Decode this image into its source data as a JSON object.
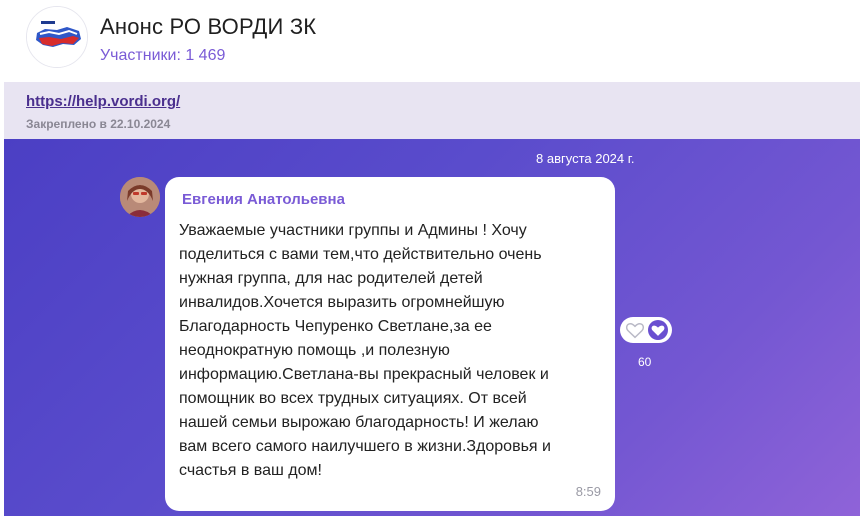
{
  "header": {
    "title": "Анонс РО ВОРДИ ЗК",
    "subtitle": "Участники: 1 469"
  },
  "pinned": {
    "link": "https://help.vordi.org/",
    "date": "Закреплено в 22.10.2024"
  },
  "chat": {
    "date_separator": "8 августа 2024 г.",
    "message": {
      "sender": "Евгения Анатольевна",
      "text": "Уважаемые участники группы и Админы ! Хочу\nподелиться с вами тем,что действительно очень\nнужная группа, для нас родителей детей\nинвалидов.Хочется выразить огромнейшую\nБлагодарность Чепуренко Светлане,за ее\nнеоднократную помощь ,и полезную\nинформацию.Светлана-вы прекрасный человек и\nпомощник во всех трудных ситуациях. От всей\nнашей семьи вырожаю благодарность! И желаю\nвам всего самого наилучшего в жизни.Здоровья и\nсчастья в ваш дом!",
      "time": "8:59"
    },
    "reactions": {
      "count": "60"
    }
  },
  "colors": {
    "accent": "#7a5bd6",
    "chat_bg_start": "#4b3fc4",
    "chat_bg_end": "#8f63d8",
    "pinned_bg": "#e8e4f2"
  }
}
